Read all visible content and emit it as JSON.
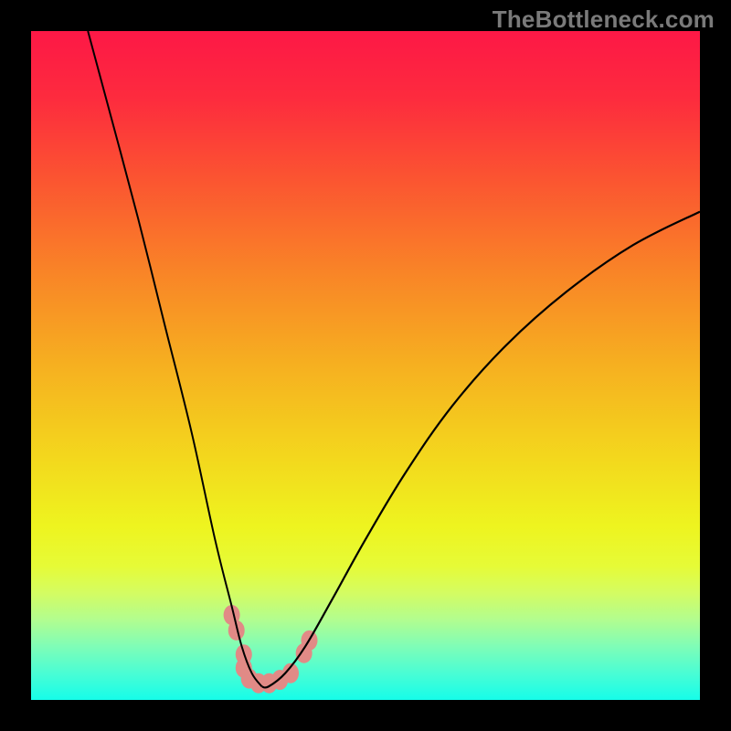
{
  "watermark": "TheBottleneck.com",
  "gradient": {
    "stops": [
      {
        "offset": 0.0,
        "color": "#fd1846"
      },
      {
        "offset": 0.1,
        "color": "#fd2b3e"
      },
      {
        "offset": 0.22,
        "color": "#fb5431"
      },
      {
        "offset": 0.36,
        "color": "#f98427"
      },
      {
        "offset": 0.5,
        "color": "#f6b020"
      },
      {
        "offset": 0.64,
        "color": "#f3d81d"
      },
      {
        "offset": 0.74,
        "color": "#eef41f"
      },
      {
        "offset": 0.8,
        "color": "#e6fb37"
      },
      {
        "offset": 0.84,
        "color": "#d4fc62"
      },
      {
        "offset": 0.88,
        "color": "#b2fd8f"
      },
      {
        "offset": 0.92,
        "color": "#7ffdb7"
      },
      {
        "offset": 0.96,
        "color": "#4afdd4"
      },
      {
        "offset": 1.0,
        "color": "#16fde9"
      }
    ]
  },
  "chart_data": {
    "type": "line",
    "title": "",
    "xlabel": "",
    "ylabel": "",
    "xlim": [
      0,
      1
    ],
    "ylim": [
      0,
      1
    ],
    "note": "x,y normalized to plot area; y=0 at top. V-shaped bottleneck curve with minimum near x≈0.35.",
    "series": [
      {
        "name": "bottleneck-curve",
        "x": [
          0.085,
          0.12,
          0.16,
          0.2,
          0.24,
          0.275,
          0.3,
          0.315,
          0.33,
          0.345,
          0.355,
          0.38,
          0.41,
          0.45,
          0.5,
          0.56,
          0.63,
          0.71,
          0.8,
          0.9,
          1.0
        ],
        "y": [
          0.0,
          0.13,
          0.28,
          0.44,
          0.6,
          0.76,
          0.86,
          0.92,
          0.96,
          0.98,
          0.98,
          0.96,
          0.92,
          0.85,
          0.76,
          0.66,
          0.56,
          0.47,
          0.39,
          0.32,
          0.27
        ]
      }
    ],
    "markers": {
      "name": "near-minimum-blobs",
      "color": "#e18a86",
      "points": [
        {
          "x": 0.3,
          "y": 0.873
        },
        {
          "x": 0.307,
          "y": 0.896
        },
        {
          "x": 0.318,
          "y": 0.932
        },
        {
          "x": 0.318,
          "y": 0.952
        },
        {
          "x": 0.326,
          "y": 0.968
        },
        {
          "x": 0.34,
          "y": 0.975
        },
        {
          "x": 0.356,
          "y": 0.975
        },
        {
          "x": 0.372,
          "y": 0.97
        },
        {
          "x": 0.388,
          "y": 0.96
        },
        {
          "x": 0.408,
          "y": 0.93
        },
        {
          "x": 0.416,
          "y": 0.911
        }
      ]
    }
  }
}
